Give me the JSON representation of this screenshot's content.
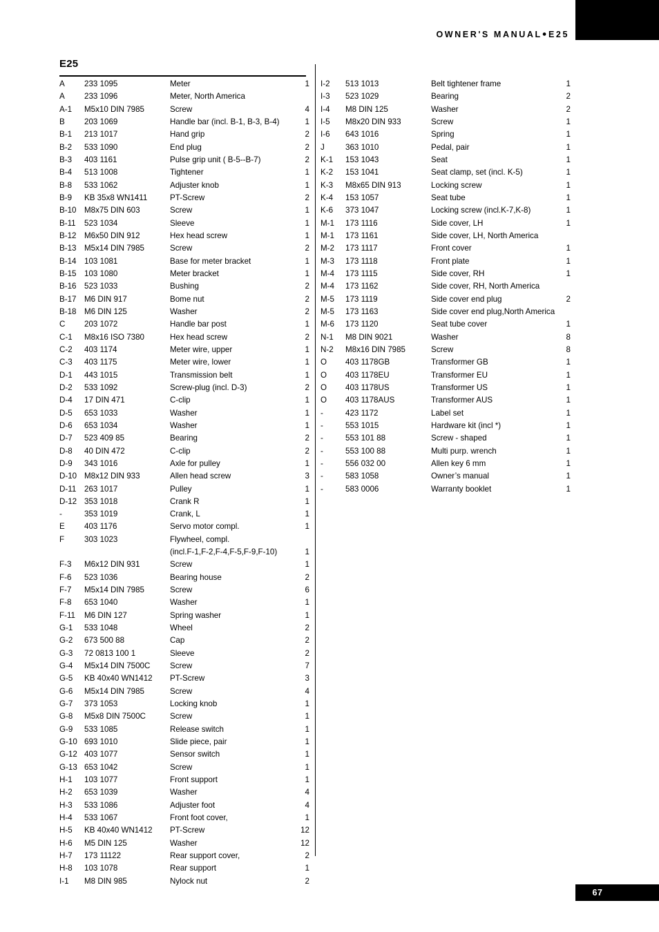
{
  "header": {
    "title_text": "OWNER'S MANUAL",
    "separator": "●",
    "model": "E25"
  },
  "footer": {
    "page_number": "67"
  },
  "section": {
    "title": "E25"
  },
  "table": {
    "left_column": [
      {
        "ref": "A",
        "pn": "233  1095",
        "desc": "Meter",
        "qty": "1"
      },
      {
        "ref": "A",
        "pn": "233  1096",
        "desc": "Meter, North America",
        "qty": ""
      },
      {
        "ref": "A-1",
        "pn": "M5x10 DIN 7985",
        "desc": "Screw",
        "qty": "4"
      },
      {
        "ref": "B",
        "pn": "203 1069",
        "desc": "Handle bar  (incl. B-1, B-3, B-4)",
        "qty": "1"
      },
      {
        "ref": "B-1",
        "pn": "213 1017",
        "desc": "Hand grip",
        "qty": "2"
      },
      {
        "ref": "B-2",
        "pn": "533 1090",
        "desc": "End plug",
        "qty": "2"
      },
      {
        "ref": "B-3",
        "pn": "403 1161",
        "desc": "Pulse grip unit ( B-5--B-7)",
        "qty": "2"
      },
      {
        "ref": "B-4",
        "pn": "513 1008",
        "desc": "Tightener",
        "qty": "1"
      },
      {
        "ref": "B-8",
        "pn": "533 1062",
        "desc": "Adjuster knob",
        "qty": "1"
      },
      {
        "ref": "B-9",
        "pn": "KB 35x8 WN1411",
        "desc": "PT-Screw",
        "qty": "2"
      },
      {
        "ref": "B-10",
        "pn": "M8x75 DIN 603",
        "desc": "Screw",
        "qty": "1"
      },
      {
        "ref": "B-11",
        "pn": "523 1034",
        "desc": "Sleeve",
        "qty": "1"
      },
      {
        "ref": "B-12",
        "pn": "M6x50 DIN 912",
        "desc": "Hex head screw",
        "qty": "1"
      },
      {
        "ref": "B-13",
        "pn": "M5x14 DIN 7985",
        "desc": "Screw",
        "qty": "2"
      },
      {
        "ref": "B-14",
        "pn": "103 1081",
        "desc": "Base for meter bracket",
        "qty": "1"
      },
      {
        "ref": "B-15",
        "pn": "103 1080",
        "desc": "Meter bracket",
        "qty": "1"
      },
      {
        "ref": "B-16",
        "pn": "523 1033",
        "desc": "Bushing",
        "qty": "2"
      },
      {
        "ref": "B-17",
        "pn": "M6 DIN 917",
        "desc": "Bome nut",
        "qty": "2"
      },
      {
        "ref": "B-18",
        "pn": "M6 DIN 125",
        "desc": "Washer",
        "qty": "2"
      },
      {
        "ref": "C",
        "pn": "203 1072",
        "desc": "Handle bar post",
        "qty": "1"
      },
      {
        "ref": "C-1",
        "pn": "M8x16 ISO 7380",
        "desc": "Hex head screw",
        "qty": "2"
      },
      {
        "ref": "C-2",
        "pn": "403 1174",
        "desc": "Meter wire, upper",
        "qty": "1"
      },
      {
        "ref": "C-3",
        "pn": "403 1175",
        "desc": "Meter wire, lower",
        "qty": "1"
      },
      {
        "ref": "D-1",
        "pn": "443 1015",
        "desc": "Transmission belt",
        "qty": "1"
      },
      {
        "ref": "D-2",
        "pn": "533 1092",
        "desc": "Screw-plug (incl. D-3)",
        "qty": "2"
      },
      {
        "ref": "D-4",
        "pn": "17 DIN 471",
        "desc": "C-clip",
        "qty": "1"
      },
      {
        "ref": "D-5",
        "pn": "653 1033",
        "desc": "Washer",
        "qty": "1"
      },
      {
        "ref": "D-6",
        "pn": "653 1034",
        "desc": "Washer",
        "qty": "1"
      },
      {
        "ref": "D-7",
        "pn": "523 409 85",
        "desc": "Bearing",
        "qty": "2"
      },
      {
        "ref": "D-8",
        "pn": "40 DIN 472",
        "desc": "C-clip",
        "qty": "2"
      },
      {
        "ref": "D-9",
        "pn": "343 1016",
        "desc": "Axle for pulley",
        "qty": "1"
      },
      {
        "ref": "D-10",
        "pn": "M8x12 DIN 933",
        "desc": "Allen head screw",
        "qty": "3"
      },
      {
        "ref": "D-11",
        "pn": "263 1017",
        "desc": "Pulley",
        "qty": "1"
      },
      {
        "ref": "D-12",
        "pn": "353 1018",
        "desc": "Crank R",
        "qty": "1"
      },
      {
        "ref": "-",
        "pn": "353 1019",
        "desc": "Crank, L",
        "qty": "1"
      },
      {
        "ref": "E",
        "pn": "403 1176",
        "desc": "Servo motor compl.",
        "qty": "1"
      },
      {
        "ref": "F",
        "pn": "303 1023",
        "desc": "Flywheel, compl.",
        "qty": ""
      },
      {
        "ref": "",
        "pn": "",
        "desc": "(incl.F-1,F-2,F-4,F-5,F-9,F-10)",
        "qty": "1"
      },
      {
        "ref": "F-3",
        "pn": "M6x12 DIN 931",
        "desc": "Screw",
        "qty": "1"
      },
      {
        "ref": "F-6",
        "pn": "523 1036",
        "desc": "Bearing house",
        "qty": "2"
      },
      {
        "ref": "F-7",
        "pn": "M5x14 DIN 7985",
        "desc": "Screw",
        "qty": "6"
      },
      {
        "ref": "F-8",
        "pn": "653 1040",
        "desc": "Washer",
        "qty": "1"
      },
      {
        "ref": "F-11",
        "pn": "M6 DIN 127",
        "desc": "Spring washer",
        "qty": "1"
      },
      {
        "ref": "G-1",
        "pn": "533 1048",
        "desc": "Wheel",
        "qty": "2"
      },
      {
        "ref": "G-2",
        "pn": "673 500 88",
        "desc": "Cap",
        "qty": "2"
      },
      {
        "ref": "G-3",
        "pn": "72 0813 100 1",
        "desc": "Sleeve",
        "qty": "2"
      },
      {
        "ref": "G-4",
        "pn": "M5x14 DIN 7500C",
        "desc": "Screw",
        "qty": "7"
      },
      {
        "ref": "G-5",
        "pn": "KB 40x40 WN1412",
        "desc": "PT-Screw",
        "qty": "3"
      },
      {
        "ref": "G-6",
        "pn": "M5x14 DIN 7985",
        "desc": "Screw",
        "qty": "4"
      },
      {
        "ref": "G-7",
        "pn": "373 1053",
        "desc": "Locking knob",
        "qty": "1"
      },
      {
        "ref": "G-8",
        "pn": "M5x8 DIN 7500C",
        "desc": "Screw",
        "qty": "1"
      },
      {
        "ref": "G-9",
        "pn": "533 1085",
        "desc": "Release switch",
        "qty": "1"
      },
      {
        "ref": "G-10",
        "pn": "693 1010",
        "desc": "Slide piece, pair",
        "qty": "1"
      },
      {
        "ref": "G-12",
        "pn": "403 1077",
        "desc": "Sensor switch",
        "qty": "1"
      },
      {
        "ref": "G-13",
        "pn": "653 1042",
        "desc": "Screw",
        "qty": "1"
      },
      {
        "ref": "H-1",
        "pn": "103 1077",
        "desc": "Front support",
        "qty": "1"
      },
      {
        "ref": "H-2",
        "pn": "653 1039",
        "desc": "Washer",
        "qty": "4"
      },
      {
        "ref": "H-3",
        "pn": "533 1086",
        "desc": "Adjuster foot",
        "qty": "4"
      },
      {
        "ref": "H-4",
        "pn": "533 1067",
        "desc": "Front foot cover,",
        "qty": "1"
      },
      {
        "ref": "H-5",
        "pn": "KB 40x40 WN1412",
        "desc": "PT-Screw",
        "qty": "12"
      },
      {
        "ref": "H-6",
        "pn": "M5 DIN 125",
        "desc": "Washer",
        "qty": "12"
      },
      {
        "ref": "H-7",
        "pn": "173 11122",
        "desc": "Rear support cover,",
        "qty": "2"
      },
      {
        "ref": "H-8",
        "pn": "103 1078",
        "desc": "Rear support",
        "qty": "1"
      },
      {
        "ref": "I-1",
        "pn": "M8 DIN 985",
        "desc": "Nylock nut",
        "qty": "2"
      }
    ],
    "right_column": [
      {
        "ref": "I-2",
        "pn": "513 1013",
        "desc": "Belt tightener frame",
        "qty": "1"
      },
      {
        "ref": "I-3",
        "pn": "523 1029",
        "desc": "Bearing",
        "qty": "2"
      },
      {
        "ref": "I-4",
        "pn": "M8 DIN 125",
        "desc": "Washer",
        "qty": "2"
      },
      {
        "ref": "I-5",
        "pn": "M8x20 DIN 933",
        "desc": "Screw",
        "qty": "1"
      },
      {
        "ref": "I-6",
        "pn": "643 1016",
        "desc": "Spring",
        "qty": "1"
      },
      {
        "ref": "J",
        "pn": "363 1010",
        "desc": "Pedal, pair",
        "qty": "1"
      },
      {
        "ref": "K-1",
        "pn": "153 1043",
        "desc": "Seat",
        "qty": "1"
      },
      {
        "ref": "K-2",
        "pn": "153 1041",
        "desc": "Seat clamp, set (incl. K-5)",
        "qty": "1"
      },
      {
        "ref": "K-3",
        "pn": "M8x65 DIN 913",
        "desc": "Locking screw",
        "qty": "1"
      },
      {
        "ref": "K-4",
        "pn": "153 1057",
        "desc": "Seat tube",
        "qty": "1"
      },
      {
        "ref": "K-6",
        "pn": "373 1047",
        "desc": "Locking screw (incl.K-7,K-8)",
        "qty": "1"
      },
      {
        "ref": "M-1",
        "pn": "173 1116",
        "desc": "Side cover, LH",
        "qty": "1"
      },
      {
        "ref": "M-1",
        "pn": "173 1161",
        "desc": "Side cover, LH, North America",
        "qty": ""
      },
      {
        "ref": "M-2",
        "pn": "173 1117",
        "desc": "Front cover",
        "qty": "1"
      },
      {
        "ref": "M-3",
        "pn": "173 1118",
        "desc": "Front plate",
        "qty": "1"
      },
      {
        "ref": "M-4",
        "pn": "173 1115",
        "desc": "Side cover, RH",
        "qty": "1"
      },
      {
        "ref": "M-4",
        "pn": "173 1162",
        "desc": "Side cover, RH, North America",
        "qty": ""
      },
      {
        "ref": "M-5",
        "pn": "173 1119",
        "desc": "Side cover end plug",
        "qty": "2"
      },
      {
        "ref": "M-5",
        "pn": "173 1163",
        "desc": "Side cover end plug,North America",
        "qty": ""
      },
      {
        "ref": "M-6",
        "pn": "173 1120",
        "desc": "Seat tube cover",
        "qty": "1"
      },
      {
        "ref": "N-1",
        "pn": "M8 DIN 9021",
        "desc": "Washer",
        "qty": "8"
      },
      {
        "ref": "N-2",
        "pn": "M8x16 DIN 7985",
        "desc": "Screw",
        "qty": "8"
      },
      {
        "ref": "O",
        "pn": "403 1178GB",
        "desc": "Transformer GB",
        "qty": "1"
      },
      {
        "ref": "O",
        "pn": "403 1178EU",
        "desc": "Transformer EU",
        "qty": "1"
      },
      {
        "ref": "O",
        "pn": "403 1178US",
        "desc": "Transformer US",
        "qty": "1"
      },
      {
        "ref": "O",
        "pn": "403  1178AUS",
        "desc": "Transformer AUS",
        "qty": "1"
      },
      {
        "ref": "-",
        "pn": "423 1172",
        "desc": "Label set",
        "qty": "1"
      },
      {
        "ref": "-",
        "pn": "553 1015",
        "desc": "Hardware kit (incl *)",
        "qty": "1"
      },
      {
        "ref": "-",
        "pn": "553 101 88",
        "desc": "Screw - shaped",
        "qty": "1"
      },
      {
        "ref": "-",
        "pn": "553 100 88",
        "desc": "Multi purp. wrench",
        "qty": "1"
      },
      {
        "ref": "-",
        "pn": "556 032 00",
        "desc": "Allen key 6 mm",
        "qty": "1"
      },
      {
        "ref": "-",
        "pn": "583 1058",
        "desc": "Owner’s manual",
        "qty": "1"
      },
      {
        "ref": "-",
        "pn": "583 0006",
        "desc": "Warranty booklet",
        "qty": "1"
      }
    ]
  }
}
